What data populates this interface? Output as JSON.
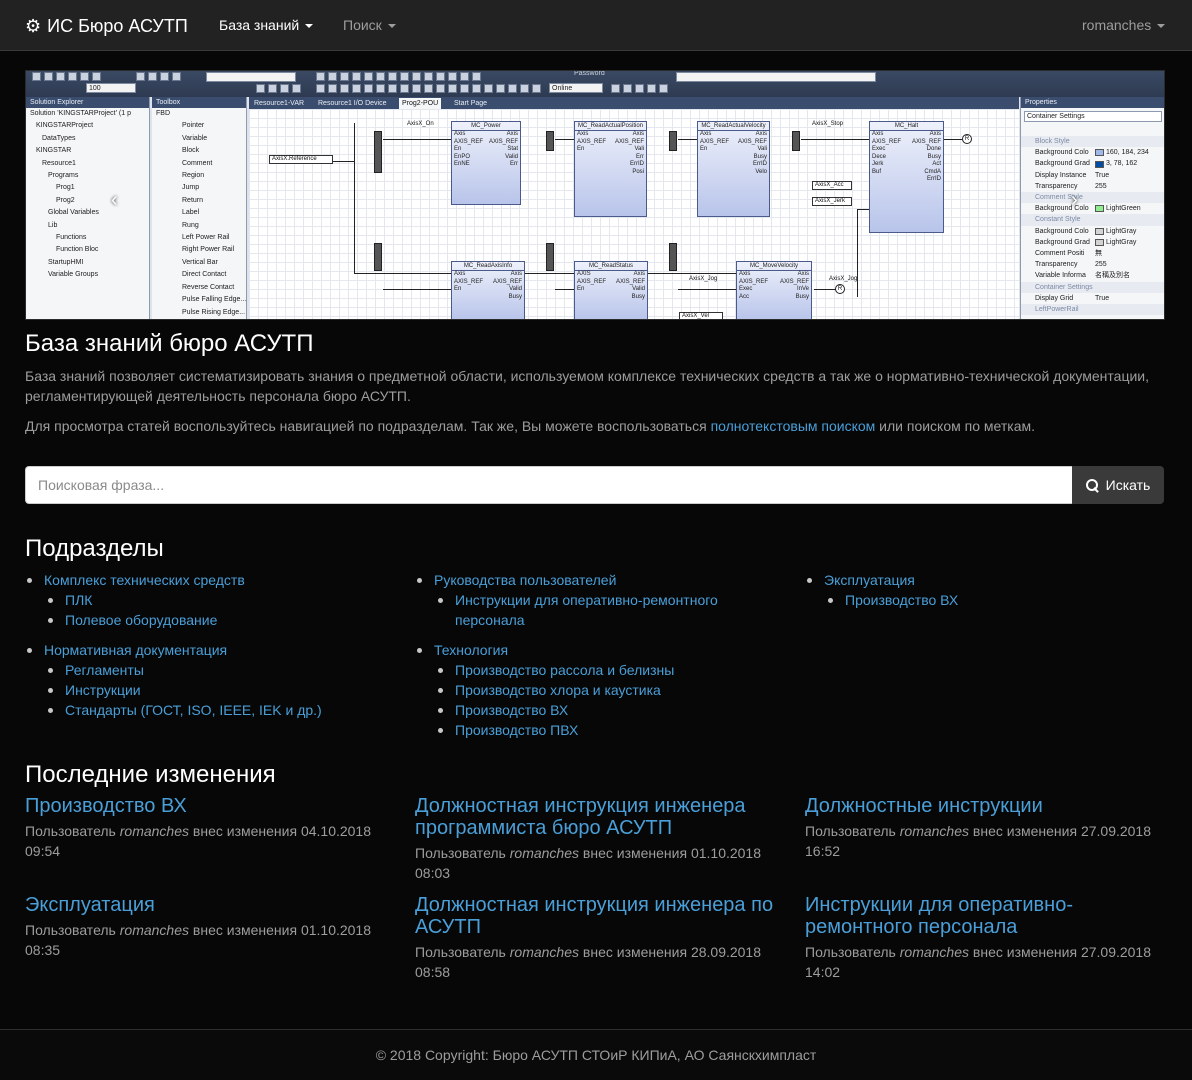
{
  "navbar": {
    "brand": "ИС Бюро АСУТП",
    "menu": [
      {
        "label": "База знаний",
        "active": true
      },
      {
        "label": "Поиск",
        "active": false
      }
    ],
    "user": "romanches"
  },
  "banner": {
    "toolbar": {
      "online_label": "Online",
      "zoom": "100",
      "password_label": "Password"
    },
    "solution_explorer": {
      "title": "Solution Explorer",
      "items": [
        "Solution 'KINGSTARProject' (1 p",
        "KINGSTARProject",
        "DataTypes",
        "KINGSTAR",
        "Resource1",
        "Programs",
        "Prog1",
        "Prog2",
        "Global Variables",
        "Lib",
        "Functions",
        "Function Bloc",
        "StartupHMI",
        "Variable Groups"
      ]
    },
    "toolbox": {
      "title": "Toolbox",
      "items": [
        "FBD",
        "Pointer",
        "Variable",
        "Block",
        "Comment",
        "Region",
        "Jump",
        "Return",
        "Label",
        "Rung",
        "Left Power Rail",
        "Right Power Rail",
        "Vertical Bar",
        "Direct Contact",
        "Reverse Contact",
        "Pulse Falling Edge...",
        "Pulse Rising Edge..."
      ]
    },
    "tabs": [
      "Resource1-VAR",
      "Resource1 I/O Device",
      "Prog2-POU",
      "Start Page"
    ],
    "blocks": [
      {
        "title": "MC_Power",
        "instance": "MC_Power_1"
      },
      {
        "title": "MC_ReadActualPosition",
        "instance": "MC_ReadActualPositio"
      },
      {
        "title": "MC_ReadActualVelocity",
        "instance": "MC_ReadActualVelocit"
      },
      {
        "title": "MC_Halt",
        "instance": "MC_Halt_1"
      },
      {
        "title": "MC_ReadAxisInfo",
        "instance": "MC_ReadAxisInfo_1"
      },
      {
        "title": "MC_ReadStatus",
        "instance": "MC_ReadStatus_1"
      },
      {
        "title": "MC_MoveVelocity",
        "instance": "MC_MoveVelocity_1"
      }
    ],
    "vars": [
      "AxisX.Reference",
      "AxisX_On",
      "AxisX_Stop",
      "AxisX_Acc",
      "AxisX_Jerk",
      "AxisX_Jog",
      "AxisX_Vel",
      "AxisX_Jog"
    ],
    "properties": {
      "title": "Properties",
      "combo": "Container Settings",
      "rows": [
        {
          "section": "Block Style"
        },
        {
          "key": "Background Colo",
          "value": "160, 184, 234",
          "color": "#a0b8ea"
        },
        {
          "key": "Background Grad",
          "value": "3, 78, 162",
          "color": "#034ea2"
        },
        {
          "key": "Display Instance",
          "value": "True"
        },
        {
          "key": "Transparency",
          "value": "255"
        },
        {
          "section": "Comment Style"
        },
        {
          "key": "Background Colo",
          "value": "LightGreen",
          "color": "#90ee90"
        },
        {
          "section": "Constant Style"
        },
        {
          "key": "Background Colo",
          "value": "LightGray",
          "color": "#d3d3d3"
        },
        {
          "key": "Background Grad",
          "value": "LightGray",
          "color": "#d3d3d3"
        },
        {
          "key": "Comment Positi",
          "value": "無"
        },
        {
          "key": "Transparency",
          "value": "255"
        },
        {
          "key": "Variable Informa",
          "value": "名稱及別名"
        },
        {
          "section": "Container Settings"
        },
        {
          "key": "Display Grid",
          "value": "True"
        },
        {
          "section": "LeftPowerRail"
        }
      ]
    }
  },
  "intro": {
    "title": "База знаний бюро АСУТП",
    "lead": "База знаний позволяет систематизировать знания о предметной области, используемом комплексе технических средств а так же о нормативно-технической документации, регламентирующей деятельность персонала бюро АСУТП.",
    "hint_before": "Для просмотра статей воспользуйтесь навигацией по подразделам. Так же, Вы можете воспользоваться ",
    "hint_link": "полнотекстовым поиском",
    "hint_after": " или поиском по меткам."
  },
  "search": {
    "placeholder": "Поисковая фраза...",
    "button": "Искать"
  },
  "subsections": {
    "title": "Подразделы",
    "columns": [
      [
        {
          "label": "Комплекс технических средств",
          "children": [
            "ПЛК",
            "Полевое оборудование"
          ]
        },
        {
          "label": "Нормативная документация",
          "children": [
            "Регламенты",
            "Инструкции",
            "Стандарты (ГОСТ, ISO, IEEE, IEK и др.)"
          ]
        }
      ],
      [
        {
          "label": "Руководства пользователей",
          "children": [
            "Инструкции для оперативно-ремонтного персонала"
          ]
        },
        {
          "label": "Технология",
          "children": [
            "Производство рассола и белизны",
            "Производство хлора и каустика",
            "Производство ВХ",
            "Производство ПВХ"
          ]
        }
      ],
      [
        {
          "label": "Эксплуатация",
          "children": [
            "Производство ВХ"
          ]
        }
      ]
    ]
  },
  "changes": {
    "title": "Последние изменения",
    "user_prefix": "Пользователь",
    "user_suffix": "внес изменения",
    "items": [
      {
        "title": "Производство ВХ",
        "user": "romanches",
        "date": "04.10.2018",
        "time": "09:54"
      },
      {
        "title": "Должностная инструкция инженера программиста бюро АСУТП",
        "user": "romanches",
        "date": "01.10.2018",
        "time": "08:03"
      },
      {
        "title": "Должностные инструкции",
        "user": "romanches",
        "date": "27.09.2018",
        "time": "16:52"
      },
      {
        "title": "Эксплуатация",
        "user": "romanches",
        "date": "01.10.2018",
        "time": "08:35"
      },
      {
        "title": "Должностная инструкция инженера по АСУТП",
        "user": "romanches",
        "date": "28.09.2018",
        "time": "08:58"
      },
      {
        "title": "Инструкции для оперативно-ремонтного персонала",
        "user": "romanches",
        "date": "27.09.2018",
        "time": "14:02"
      }
    ]
  },
  "footer": {
    "text": "© 2018 Copyright: Бюро АСУТП СТОиР КИПиА, АО Саянскхимпласт"
  }
}
